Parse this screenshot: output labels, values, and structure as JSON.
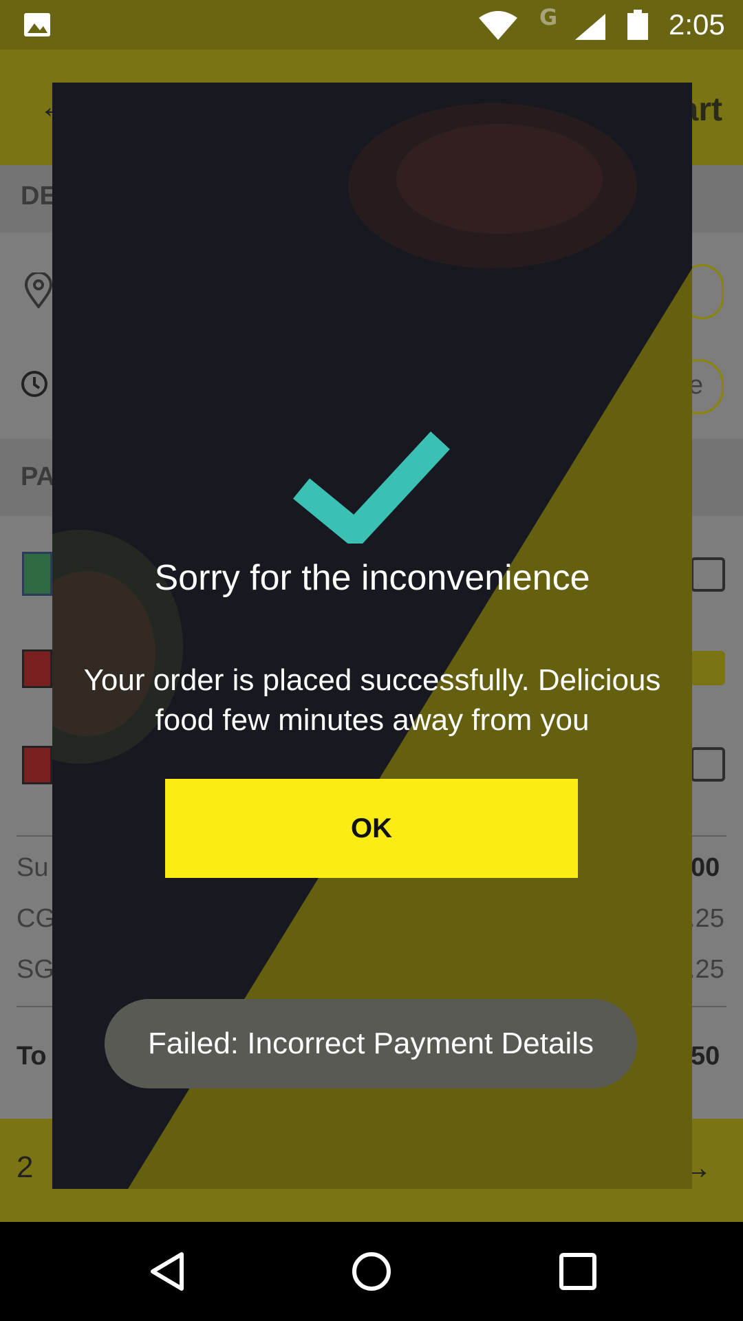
{
  "status_bar": {
    "time": "2:05",
    "network_type": "G",
    "icons": [
      "image-icon",
      "wifi-icon",
      "signal-icon",
      "battery-icon"
    ]
  },
  "background_app": {
    "title_fragment": "art",
    "section_1_fragment": "DE",
    "section_2_fragment": "PA",
    "summary_rows": [
      {
        "label_fragment": "Su",
        "value_fragment": "00"
      },
      {
        "label_fragment": "CG",
        "value_fragment": ".25"
      },
      {
        "label_fragment": "SG",
        "value_fragment": ".25"
      }
    ],
    "total_label_fragment": "To",
    "total_value_fragment": "50",
    "time_pill_fragment": "e",
    "bottom_count": "2"
  },
  "dialog": {
    "title": "Sorry for the inconvenience",
    "message": "Your order is placed successfully. Delicious food few minutes away from you",
    "ok_label": "OK",
    "check_color": "#3bc1b4",
    "accent_color": "#fbed13"
  },
  "toast": {
    "text": "Failed: Incorrect Payment Details"
  }
}
